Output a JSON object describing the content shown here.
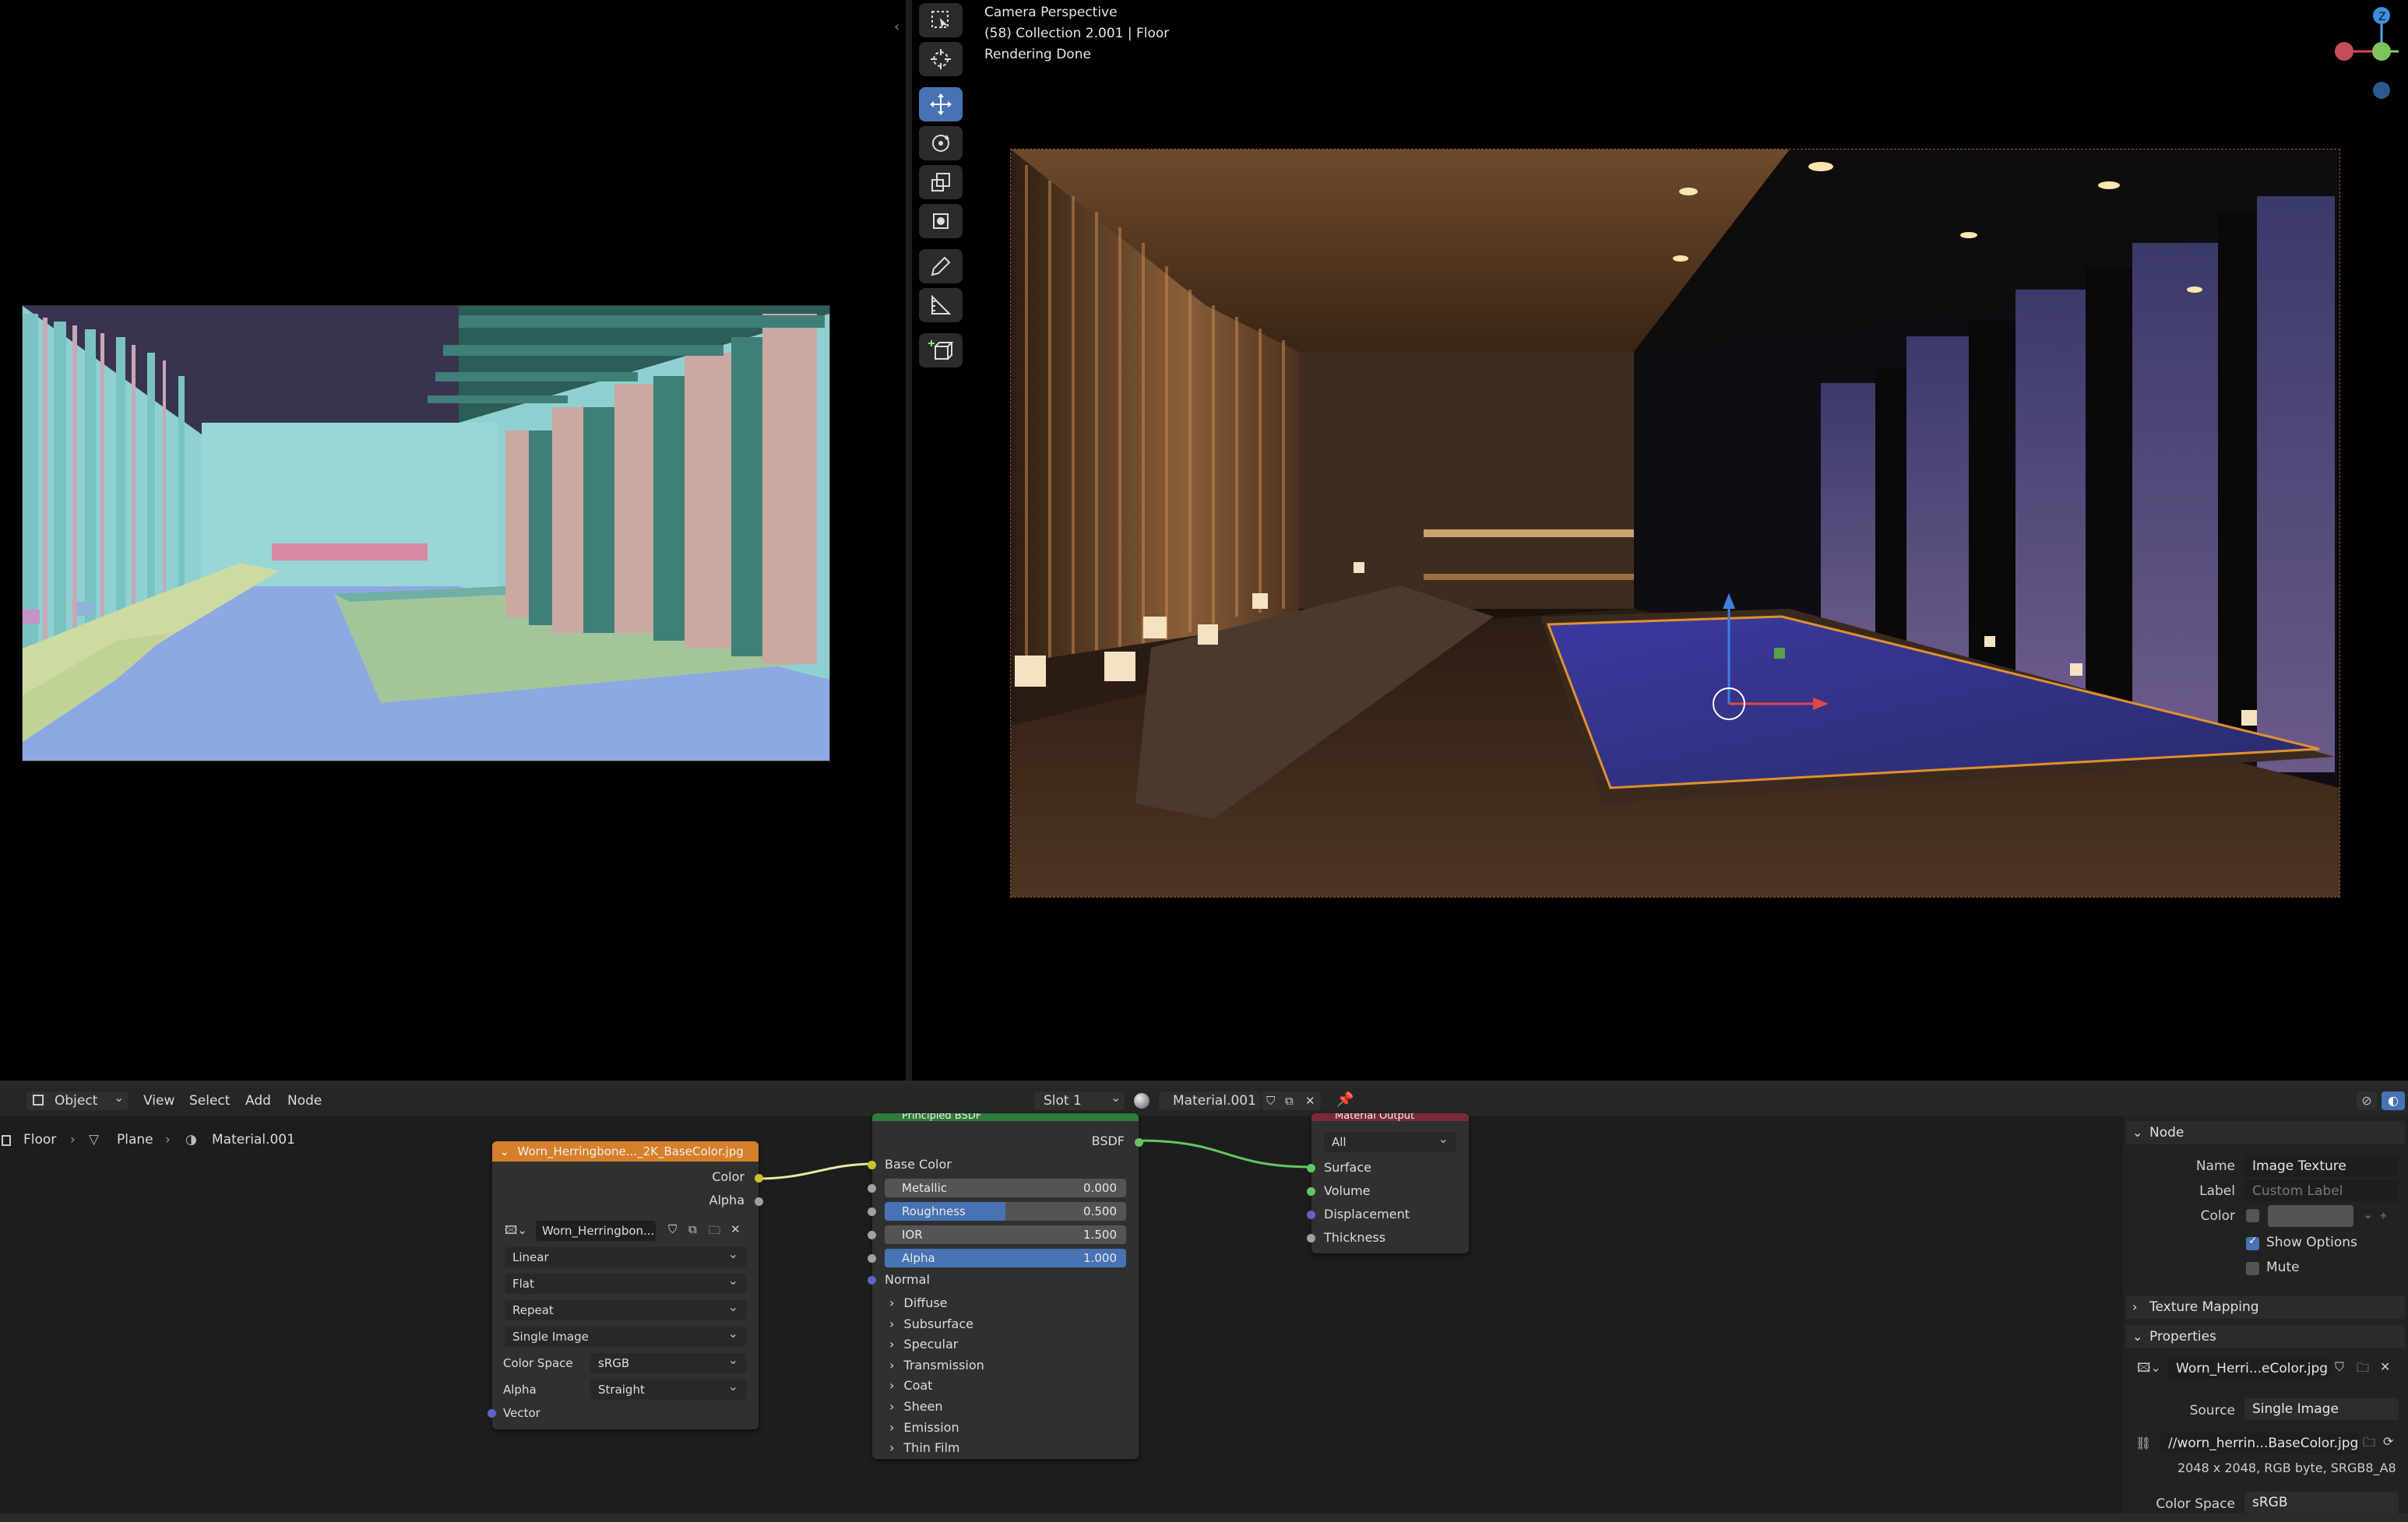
{
  "viewport": {
    "camera_label": "Camera Perspective",
    "collection_label": "(58) Collection 2.001 | Floor",
    "status_label": "Rendering Done"
  },
  "gizmo": {
    "z": "Z"
  },
  "node_editor": {
    "header": {
      "mode": "Object",
      "menus": [
        "View",
        "Select",
        "Add",
        "Node"
      ],
      "slot": "Slot 1",
      "material": "Material.001"
    },
    "breadcrumb": [
      "Floor",
      "Plane",
      "Material.001"
    ],
    "image_texture_node": {
      "title": "Worn_Herringbone..._2K_BaseColor.jpg",
      "out_color": "Color",
      "out_alpha": "Alpha",
      "image_name": "Worn_Herringbon...",
      "interpolation": "Linear",
      "projection": "Flat",
      "extension": "Repeat",
      "source": "Single Image",
      "color_space_label": "Color Space",
      "color_space": "sRGB",
      "alpha_label": "Alpha",
      "alpha_mode": "Straight",
      "vector": "Vector"
    },
    "bsdf_node": {
      "title": "Principled BSDF",
      "out": "BSDF",
      "base_color": "Base Color",
      "metallic_label": "Metallic",
      "metallic": "0.000",
      "roughness_label": "Roughness",
      "roughness": "0.500",
      "roughness_fill": 0.5,
      "ior_label": "IOR",
      "ior": "1.500",
      "alpha_label": "Alpha",
      "alpha": "1.000",
      "alpha_fill": 1.0,
      "normal": "Normal",
      "panels": [
        "Diffuse",
        "Subsurface",
        "Specular",
        "Transmission",
        "Coat",
        "Sheen",
        "Emission",
        "Thin Film"
      ]
    },
    "output_node": {
      "title": "Material Output",
      "target": "All",
      "inputs": [
        "Surface",
        "Volume",
        "Displacement",
        "Thickness"
      ]
    }
  },
  "sidebar": {
    "node_section": "Node",
    "name_label": "Name",
    "name_value": "Image Texture",
    "label_label": "Label",
    "label_placeholder": "Custom Label",
    "color_label": "Color",
    "show_options": "Show Options",
    "mute": "Mute",
    "texture_mapping": "Texture Mapping",
    "properties": "Properties",
    "image_name": "Worn_Herri...eColor.jpg",
    "source_label": "Source",
    "source_value": "Single Image",
    "path": "//worn_herrin...BaseColor.jpg",
    "image_info": "2048 x 2048,  RGB byte, SRGB8_A8",
    "color_space_label": "Color Space",
    "color_space_value": "sRGB"
  },
  "colors": {
    "accent": "#4772b3",
    "image_node_header": "#d67f2a",
    "bsdf_header": "#2f7b3a",
    "output_header": "#7a2a36"
  }
}
